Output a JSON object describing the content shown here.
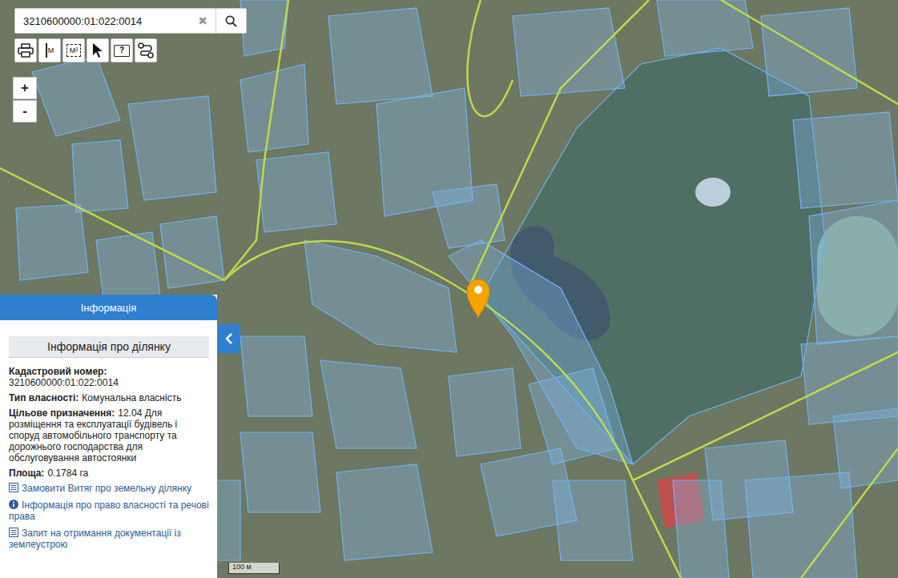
{
  "search": {
    "value": "3210600000:01:022:0014",
    "clear": "✖"
  },
  "tools": [
    {
      "kind": "print"
    },
    {
      "kind": "distance",
      "label": "M"
    },
    {
      "kind": "area",
      "label": "M²"
    },
    {
      "kind": "select"
    },
    {
      "kind": "help",
      "label": "?"
    },
    {
      "kind": "route"
    }
  ],
  "zoom": [
    "+",
    "-"
  ],
  "panel": {
    "title": "Інформація",
    "heading": "Інформація про ділянку",
    "fields": [
      {
        "kind": "stacked",
        "label": "Кадастровий номер:",
        "value": "3210600000:01:022:0014"
      },
      {
        "kind": "inline",
        "label": "Тип власності:",
        "value": "Комунальна власність"
      },
      {
        "kind": "inline",
        "label": "Цільове призначення:",
        "value": "12.04 Для розміщення та експлуатації будівель і споруд автомобільного транспорту та дорожнього господарства для обслуговування автостоянки"
      },
      {
        "kind": "inline",
        "label": "Площа:",
        "value": "0.1784 га"
      }
    ],
    "links": [
      {
        "kind": "doc",
        "label": "Замовити Витяг про земельну ділянку"
      },
      {
        "kind": "info",
        "label": "Інформація про право власності та речові права"
      },
      {
        "kind": "doc",
        "label": "Запит на отримання документації із землеустрою"
      }
    ]
  },
  "scale": "100 м"
}
